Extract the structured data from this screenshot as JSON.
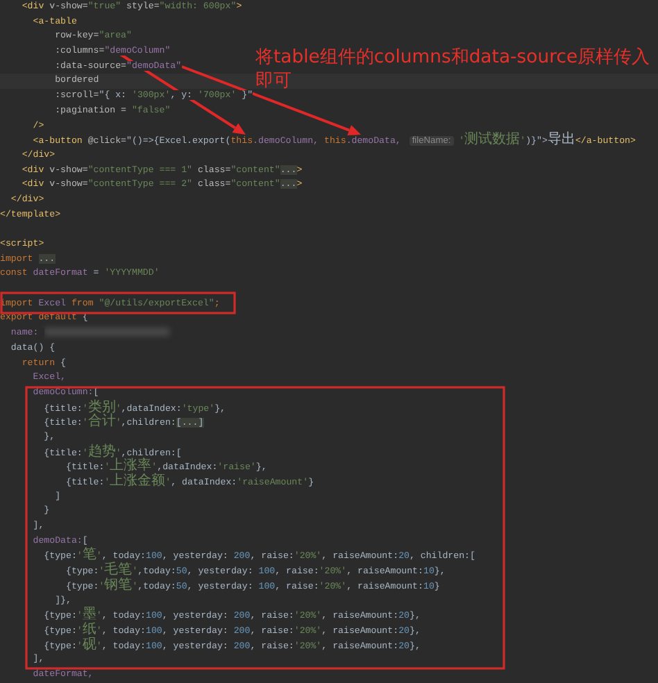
{
  "editor": {
    "lines": [
      {
        "tokens": [
          {
            "text": "    <div ",
            "kind": "tag"
          },
          {
            "text": "v-show=",
            "kind": "attr"
          },
          {
            "text": "\"true\" ",
            "kind": "string"
          },
          {
            "text": "style=",
            "kind": "attr"
          },
          {
            "text": "\"width: 600px\"",
            "kind": "string"
          },
          {
            "text": ">",
            "kind": "tag"
          }
        ]
      },
      {
        "tokens": [
          {
            "text": "      <a-table",
            "kind": "tag"
          }
        ]
      },
      {
        "tokens": [
          {
            "text": "          row-key=",
            "kind": "attr"
          },
          {
            "text": "\"area\"",
            "kind": "string"
          }
        ]
      },
      {
        "tokens": [
          {
            "text": "          :columns=",
            "kind": "attr"
          },
          {
            "text": "\"demoColumn\"",
            "kind": "field"
          }
        ]
      },
      {
        "tokens": [
          {
            "text": "          :data-source=",
            "kind": "attr"
          },
          {
            "text": "\"demoData\"",
            "kind": "field"
          }
        ]
      },
      {
        "tokens": [
          {
            "text": "          bordered",
            "kind": "attr"
          }
        ],
        "current": true
      },
      {
        "tokens": [
          {
            "text": "          :scroll=",
            "kind": "attr"
          },
          {
            "text": "\"{ x: ",
            "kind": "plain"
          },
          {
            "text": "'300px'",
            "kind": "string"
          },
          {
            "text": ", y: ",
            "kind": "plain"
          },
          {
            "text": "'700px'",
            "kind": "string"
          },
          {
            "text": " }\"",
            "kind": "plain"
          }
        ]
      },
      {
        "tokens": [
          {
            "text": "          :pagination = ",
            "kind": "attr"
          },
          {
            "text": "\"false\"",
            "kind": "string"
          }
        ]
      },
      {
        "tokens": [
          {
            "text": "      />",
            "kind": "tag"
          }
        ]
      },
      {
        "tokens": [
          {
            "text": "      <a-button ",
            "kind": "tag"
          },
          {
            "text": "@click=",
            "kind": "attr"
          },
          {
            "text": "\"()=>{Excel.export(",
            "kind": "plain"
          },
          {
            "text": "this",
            "kind": "keyword"
          },
          {
            "text": ".demoColumn, ",
            "kind": "field"
          },
          {
            "text": "this",
            "kind": "keyword"
          },
          {
            "text": ".demoData, ",
            "kind": "field"
          },
          {
            "text": "fileName:",
            "kind": "hint"
          },
          {
            "text": " '测试数据'",
            "kind": "string"
          },
          {
            "text": ")}\"",
            "kind": "plain"
          },
          {
            "text": ">导出",
            "kind": "plain"
          },
          {
            "text": "</a-button>",
            "kind": "tag"
          }
        ]
      },
      {
        "tokens": [
          {
            "text": "    </div>",
            "kind": "tag"
          }
        ]
      },
      {
        "tokens": [
          {
            "text": "    <div ",
            "kind": "tag"
          },
          {
            "text": "v-show=",
            "kind": "attr"
          },
          {
            "text": "\"contentType === 1\" ",
            "kind": "string"
          },
          {
            "text": "class=",
            "kind": "attr"
          },
          {
            "text": "\"content\"",
            "kind": "string"
          },
          {
            "text": "...",
            "kind": "fold"
          },
          {
            "text": ">",
            "kind": "tag"
          }
        ]
      },
      {
        "tokens": [
          {
            "text": "    <div ",
            "kind": "tag"
          },
          {
            "text": "v-show=",
            "kind": "attr"
          },
          {
            "text": "\"contentType === 2\" ",
            "kind": "string"
          },
          {
            "text": "class=",
            "kind": "attr"
          },
          {
            "text": "\"content\"",
            "kind": "string"
          },
          {
            "text": "...",
            "kind": "fold"
          },
          {
            "text": ">",
            "kind": "tag"
          }
        ]
      },
      {
        "tokens": [
          {
            "text": "  </div>",
            "kind": "tag"
          }
        ]
      },
      {
        "tokens": [
          {
            "text": "</template>",
            "kind": "tag"
          }
        ]
      },
      {
        "blank": true
      },
      {
        "tokens": [
          {
            "text": "<script>",
            "kind": "tag"
          }
        ]
      },
      {
        "tokens": [
          {
            "text": "import ",
            "kind": "keyword"
          },
          {
            "text": "...",
            "kind": "fold"
          }
        ]
      },
      {
        "tokens": [
          {
            "text": "const ",
            "kind": "keyword"
          },
          {
            "text": "dateFormat",
            "kind": "field"
          },
          {
            "text": " = ",
            "kind": "plain"
          },
          {
            "text": "'YYYYMMDD'",
            "kind": "string"
          }
        ]
      },
      {
        "blank": true
      },
      {
        "tokens": [
          {
            "text": "import ",
            "kind": "keyword"
          },
          {
            "text": "Excel ",
            "kind": "field"
          },
          {
            "text": "from ",
            "kind": "keyword"
          },
          {
            "text": "\"@/utils/exportExcel\"",
            "kind": "string"
          },
          {
            "text": ";",
            "kind": "keyword"
          }
        ]
      },
      {
        "tokens": [
          {
            "text": "export default ",
            "kind": "keyword"
          },
          {
            "text": "{",
            "kind": "plain"
          }
        ]
      },
      {
        "tokens": [
          {
            "text": "  name: ",
            "kind": "field"
          }
        ],
        "redacted": true
      },
      {
        "tokens": [
          {
            "text": "  data() {",
            "kind": "plain"
          }
        ]
      },
      {
        "tokens": [
          {
            "text": "    return ",
            "kind": "keyword"
          },
          {
            "text": "{",
            "kind": "plain"
          }
        ]
      },
      {
        "tokens": [
          {
            "text": "      Excel,",
            "kind": "field"
          }
        ]
      },
      {
        "tokens": [
          {
            "text": "      demoColumn:",
            "kind": "field"
          },
          {
            "text": "[",
            "kind": "plain"
          }
        ]
      },
      {
        "tokens": [
          {
            "text": "        {title:",
            "kind": "plain"
          },
          {
            "text": "'类别'",
            "kind": "string"
          },
          {
            "text": ",dataIndex:",
            "kind": "plain"
          },
          {
            "text": "'type'",
            "kind": "string"
          },
          {
            "text": "},",
            "kind": "plain"
          }
        ]
      },
      {
        "tokens": [
          {
            "text": "        {title:",
            "kind": "plain"
          },
          {
            "text": "'合计'",
            "kind": "string"
          },
          {
            "text": ",children:",
            "kind": "plain"
          },
          {
            "text": "[...]",
            "kind": "fold"
          }
        ]
      },
      {
        "tokens": [
          {
            "text": "        },",
            "kind": "plain"
          }
        ]
      },
      {
        "tokens": [
          {
            "text": "        {title:",
            "kind": "plain"
          },
          {
            "text": "'趋势'",
            "kind": "string"
          },
          {
            "text": ",children:[",
            "kind": "plain"
          }
        ]
      },
      {
        "tokens": [
          {
            "text": "            {title:",
            "kind": "plain"
          },
          {
            "text": "'上涨率'",
            "kind": "string"
          },
          {
            "text": ",dataIndex:",
            "kind": "plain"
          },
          {
            "text": "'raise'",
            "kind": "string"
          },
          {
            "text": "},",
            "kind": "plain"
          }
        ]
      },
      {
        "tokens": [
          {
            "text": "            {title:",
            "kind": "plain"
          },
          {
            "text": "'上涨金额'",
            "kind": "string"
          },
          {
            "text": ", dataIndex:",
            "kind": "plain"
          },
          {
            "text": "'raiseAmount'",
            "kind": "string"
          },
          {
            "text": "}",
            "kind": "plain"
          }
        ]
      },
      {
        "tokens": [
          {
            "text": "          ]",
            "kind": "plain"
          }
        ]
      },
      {
        "tokens": [
          {
            "text": "        }",
            "kind": "plain"
          }
        ]
      },
      {
        "tokens": [
          {
            "text": "      ],",
            "kind": "plain"
          }
        ]
      },
      {
        "tokens": [
          {
            "text": "      demoData:",
            "kind": "field"
          },
          {
            "text": "[",
            "kind": "plain"
          }
        ]
      },
      {
        "tokens": [
          {
            "text": "        {type:",
            "kind": "plain"
          },
          {
            "text": "'笔'",
            "kind": "string"
          },
          {
            "text": ", today:",
            "kind": "plain"
          },
          {
            "text": "100",
            "kind": "number"
          },
          {
            "text": ", yesterday: ",
            "kind": "plain"
          },
          {
            "text": "200",
            "kind": "number"
          },
          {
            "text": ", raise:",
            "kind": "plain"
          },
          {
            "text": "'20%'",
            "kind": "string"
          },
          {
            "text": ", raiseAmount:",
            "kind": "plain"
          },
          {
            "text": "20",
            "kind": "number"
          },
          {
            "text": ", children:[",
            "kind": "plain"
          }
        ]
      },
      {
        "tokens": [
          {
            "text": "            {type:",
            "kind": "plain"
          },
          {
            "text": "'毛笔'",
            "kind": "string"
          },
          {
            "text": ",today:",
            "kind": "plain"
          },
          {
            "text": "50",
            "kind": "number"
          },
          {
            "text": ", yesterday: ",
            "kind": "plain"
          },
          {
            "text": "100",
            "kind": "number"
          },
          {
            "text": ", raise:",
            "kind": "plain"
          },
          {
            "text": "'20%'",
            "kind": "string"
          },
          {
            "text": ", raiseAmount:",
            "kind": "plain"
          },
          {
            "text": "10",
            "kind": "number"
          },
          {
            "text": "},",
            "kind": "plain"
          }
        ]
      },
      {
        "tokens": [
          {
            "text": "            {type:",
            "kind": "plain"
          },
          {
            "text": "'钢笔'",
            "kind": "string"
          },
          {
            "text": ",today:",
            "kind": "plain"
          },
          {
            "text": "50",
            "kind": "number"
          },
          {
            "text": ", yesterday: ",
            "kind": "plain"
          },
          {
            "text": "100",
            "kind": "number"
          },
          {
            "text": ", raise:",
            "kind": "plain"
          },
          {
            "text": "'20%'",
            "kind": "string"
          },
          {
            "text": ", raiseAmount:",
            "kind": "plain"
          },
          {
            "text": "10",
            "kind": "number"
          },
          {
            "text": "}",
            "kind": "plain"
          }
        ]
      },
      {
        "tokens": [
          {
            "text": "          ]},",
            "kind": "plain"
          }
        ]
      },
      {
        "tokens": [
          {
            "text": "        {type:",
            "kind": "plain"
          },
          {
            "text": "'墨'",
            "kind": "string"
          },
          {
            "text": ", today:",
            "kind": "plain"
          },
          {
            "text": "100",
            "kind": "number"
          },
          {
            "text": ", yesterday: ",
            "kind": "plain"
          },
          {
            "text": "200",
            "kind": "number"
          },
          {
            "text": ", raise:",
            "kind": "plain"
          },
          {
            "text": "'20%'",
            "kind": "string"
          },
          {
            "text": ", raiseAmount:",
            "kind": "plain"
          },
          {
            "text": "20",
            "kind": "number"
          },
          {
            "text": "},",
            "kind": "plain"
          }
        ]
      },
      {
        "tokens": [
          {
            "text": "        {type:",
            "kind": "plain"
          },
          {
            "text": "'纸'",
            "kind": "string"
          },
          {
            "text": ", today:",
            "kind": "plain"
          },
          {
            "text": "100",
            "kind": "number"
          },
          {
            "text": ", yesterday: ",
            "kind": "plain"
          },
          {
            "text": "200",
            "kind": "number"
          },
          {
            "text": ", raise:",
            "kind": "plain"
          },
          {
            "text": "'20%'",
            "kind": "string"
          },
          {
            "text": ", raiseAmount:",
            "kind": "plain"
          },
          {
            "text": "20",
            "kind": "number"
          },
          {
            "text": "},",
            "kind": "plain"
          }
        ]
      },
      {
        "tokens": [
          {
            "text": "        {type:",
            "kind": "plain"
          },
          {
            "text": "'砚'",
            "kind": "string"
          },
          {
            "text": ", today:",
            "kind": "plain"
          },
          {
            "text": "100",
            "kind": "number"
          },
          {
            "text": ", yesterday: ",
            "kind": "plain"
          },
          {
            "text": "200",
            "kind": "number"
          },
          {
            "text": ", raise:",
            "kind": "plain"
          },
          {
            "text": "'20%'",
            "kind": "string"
          },
          {
            "text": ", raiseAmount:",
            "kind": "plain"
          },
          {
            "text": "20",
            "kind": "number"
          },
          {
            "text": "},",
            "kind": "plain"
          }
        ]
      },
      {
        "tokens": [
          {
            "text": "      ],",
            "kind": "plain"
          }
        ]
      },
      {
        "tokens": [
          {
            "text": "      dateFormat,",
            "kind": "field"
          }
        ]
      }
    ]
  },
  "annotation": {
    "note": "将table组件的columns和data-source原样传入即可"
  }
}
